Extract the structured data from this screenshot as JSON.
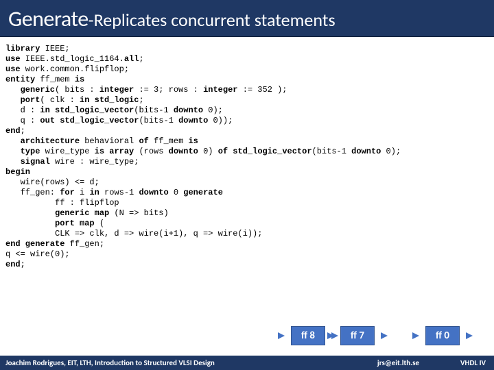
{
  "title": {
    "main": "Generate",
    "sub": "-Replicates concurrent statements"
  },
  "code": {
    "l1a": "library",
    "l1b": " IEEE;",
    "l2a": "use",
    "l2b": " IEEE.std_logic_1164.",
    "l2c": "all",
    "l2d": ";",
    "l3a": "use",
    "l3b": " work.common.flipflop;",
    "l4a": "entity",
    "l4b": " ff_mem ",
    "l4c": "is",
    "l5a": "   generic",
    "l5b": "( bits : ",
    "l5c": "integer",
    "l5d": " := 3; rows : ",
    "l5e": "integer",
    "l5f": " := 352 );",
    "l6a": "   port",
    "l6b": "( clk : ",
    "l6c": "in std_logic",
    "l6d": ";",
    "l7a": "   d : ",
    "l7b": "in std_logic_vector",
    "l7c": "(bits-1 ",
    "l7d": "downto",
    "l7e": " 0);",
    "l8a": "   q : ",
    "l8b": "out std_logic_vector",
    "l8c": "(bits-1 ",
    "l8d": "downto",
    "l8e": " 0));",
    "l9a": "end",
    "l9b": ";",
    "l10a": "   architecture",
    "l10b": " behavioral ",
    "l10c": "of",
    "l10d": " ff_mem ",
    "l10e": "is",
    "l11a": "   type",
    "l11b": " wire_type ",
    "l11c": "is array",
    "l11d": " (rows ",
    "l11e": "downto",
    "l11f": " 0) ",
    "l11g": "of std_logic_vector",
    "l11h": "(bits-1 ",
    "l11i": "downto",
    "l11j": " 0);",
    "l12a": "   signal",
    "l12b": " wire : wire_type;",
    "l13": "begin",
    "l14": "   wire(rows) <= d;",
    "l15a": "   ff_gen: ",
    "l15b": "for",
    "l15c": " i ",
    "l15d": "in",
    "l15e": " rows-1 ",
    "l15f": "downto",
    "l15g": " 0 ",
    "l15h": "generate",
    "l16": "          ff : flipflop",
    "l17a": "          generic map",
    "l17b": " (N => bits)",
    "l18a": "          port map",
    "l18b": " (",
    "l19": "          CLK => clk, d => wire(i+1), q => wire(i));",
    "l20a": "end generate",
    "l20b": " ff_gen;",
    "l21": "q <= wire(0);",
    "l22a": "end",
    "l22b": ";"
  },
  "diagram": {
    "box1": "ff 8",
    "box2": "ff 7",
    "box3": "ff 0"
  },
  "footer": {
    "left": "Joachim Rodrigues, EIT, LTH, Introduction to Structured VLSI Design",
    "mid": "jrs@eit.lth.se",
    "right": "VHDL IV"
  }
}
